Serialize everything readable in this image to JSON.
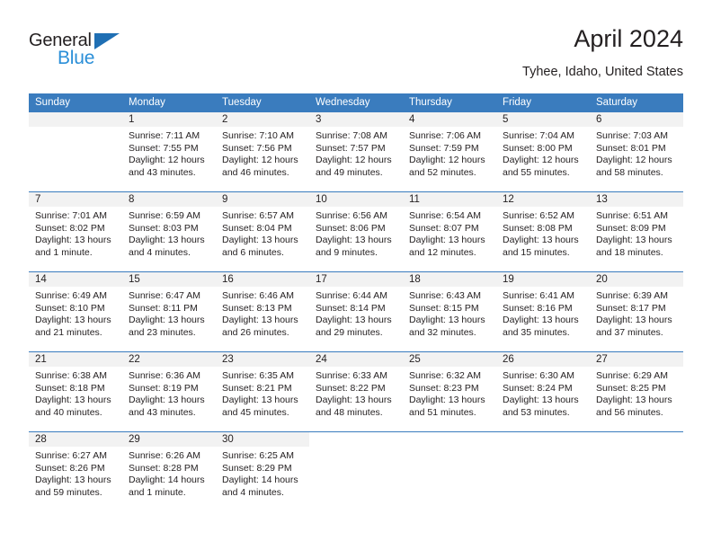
{
  "brand": {
    "name_top": "General",
    "name_bottom": "Blue"
  },
  "header": {
    "title": "April 2024",
    "subtitle": "Tyhee, Idaho, United States"
  },
  "colors": {
    "header_blue": "#3a7cbe",
    "logo_blue": "#2b8fd8",
    "daynum_band": "#f2f2f2",
    "text": "#231f20"
  },
  "weekdays": [
    "Sunday",
    "Monday",
    "Tuesday",
    "Wednesday",
    "Thursday",
    "Friday",
    "Saturday"
  ],
  "weeks": [
    [
      {
        "day": "",
        "lines": []
      },
      {
        "day": "1",
        "lines": [
          "Sunrise: 7:11 AM",
          "Sunset: 7:55 PM",
          "Daylight: 12 hours",
          "and 43 minutes."
        ]
      },
      {
        "day": "2",
        "lines": [
          "Sunrise: 7:10 AM",
          "Sunset: 7:56 PM",
          "Daylight: 12 hours",
          "and 46 minutes."
        ]
      },
      {
        "day": "3",
        "lines": [
          "Sunrise: 7:08 AM",
          "Sunset: 7:57 PM",
          "Daylight: 12 hours",
          "and 49 minutes."
        ]
      },
      {
        "day": "4",
        "lines": [
          "Sunrise: 7:06 AM",
          "Sunset: 7:59 PM",
          "Daylight: 12 hours",
          "and 52 minutes."
        ]
      },
      {
        "day": "5",
        "lines": [
          "Sunrise: 7:04 AM",
          "Sunset: 8:00 PM",
          "Daylight: 12 hours",
          "and 55 minutes."
        ]
      },
      {
        "day": "6",
        "lines": [
          "Sunrise: 7:03 AM",
          "Sunset: 8:01 PM",
          "Daylight: 12 hours",
          "and 58 minutes."
        ]
      }
    ],
    [
      {
        "day": "7",
        "lines": [
          "Sunrise: 7:01 AM",
          "Sunset: 8:02 PM",
          "Daylight: 13 hours",
          "and 1 minute."
        ]
      },
      {
        "day": "8",
        "lines": [
          "Sunrise: 6:59 AM",
          "Sunset: 8:03 PM",
          "Daylight: 13 hours",
          "and 4 minutes."
        ]
      },
      {
        "day": "9",
        "lines": [
          "Sunrise: 6:57 AM",
          "Sunset: 8:04 PM",
          "Daylight: 13 hours",
          "and 6 minutes."
        ]
      },
      {
        "day": "10",
        "lines": [
          "Sunrise: 6:56 AM",
          "Sunset: 8:06 PM",
          "Daylight: 13 hours",
          "and 9 minutes."
        ]
      },
      {
        "day": "11",
        "lines": [
          "Sunrise: 6:54 AM",
          "Sunset: 8:07 PM",
          "Daylight: 13 hours",
          "and 12 minutes."
        ]
      },
      {
        "day": "12",
        "lines": [
          "Sunrise: 6:52 AM",
          "Sunset: 8:08 PM",
          "Daylight: 13 hours",
          "and 15 minutes."
        ]
      },
      {
        "day": "13",
        "lines": [
          "Sunrise: 6:51 AM",
          "Sunset: 8:09 PM",
          "Daylight: 13 hours",
          "and 18 minutes."
        ]
      }
    ],
    [
      {
        "day": "14",
        "lines": [
          "Sunrise: 6:49 AM",
          "Sunset: 8:10 PM",
          "Daylight: 13 hours",
          "and 21 minutes."
        ]
      },
      {
        "day": "15",
        "lines": [
          "Sunrise: 6:47 AM",
          "Sunset: 8:11 PM",
          "Daylight: 13 hours",
          "and 23 minutes."
        ]
      },
      {
        "day": "16",
        "lines": [
          "Sunrise: 6:46 AM",
          "Sunset: 8:13 PM",
          "Daylight: 13 hours",
          "and 26 minutes."
        ]
      },
      {
        "day": "17",
        "lines": [
          "Sunrise: 6:44 AM",
          "Sunset: 8:14 PM",
          "Daylight: 13 hours",
          "and 29 minutes."
        ]
      },
      {
        "day": "18",
        "lines": [
          "Sunrise: 6:43 AM",
          "Sunset: 8:15 PM",
          "Daylight: 13 hours",
          "and 32 minutes."
        ]
      },
      {
        "day": "19",
        "lines": [
          "Sunrise: 6:41 AM",
          "Sunset: 8:16 PM",
          "Daylight: 13 hours",
          "and 35 minutes."
        ]
      },
      {
        "day": "20",
        "lines": [
          "Sunrise: 6:39 AM",
          "Sunset: 8:17 PM",
          "Daylight: 13 hours",
          "and 37 minutes."
        ]
      }
    ],
    [
      {
        "day": "21",
        "lines": [
          "Sunrise: 6:38 AM",
          "Sunset: 8:18 PM",
          "Daylight: 13 hours",
          "and 40 minutes."
        ]
      },
      {
        "day": "22",
        "lines": [
          "Sunrise: 6:36 AM",
          "Sunset: 8:19 PM",
          "Daylight: 13 hours",
          "and 43 minutes."
        ]
      },
      {
        "day": "23",
        "lines": [
          "Sunrise: 6:35 AM",
          "Sunset: 8:21 PM",
          "Daylight: 13 hours",
          "and 45 minutes."
        ]
      },
      {
        "day": "24",
        "lines": [
          "Sunrise: 6:33 AM",
          "Sunset: 8:22 PM",
          "Daylight: 13 hours",
          "and 48 minutes."
        ]
      },
      {
        "day": "25",
        "lines": [
          "Sunrise: 6:32 AM",
          "Sunset: 8:23 PM",
          "Daylight: 13 hours",
          "and 51 minutes."
        ]
      },
      {
        "day": "26",
        "lines": [
          "Sunrise: 6:30 AM",
          "Sunset: 8:24 PM",
          "Daylight: 13 hours",
          "and 53 minutes."
        ]
      },
      {
        "day": "27",
        "lines": [
          "Sunrise: 6:29 AM",
          "Sunset: 8:25 PM",
          "Daylight: 13 hours",
          "and 56 minutes."
        ]
      }
    ],
    [
      {
        "day": "28",
        "lines": [
          "Sunrise: 6:27 AM",
          "Sunset: 8:26 PM",
          "Daylight: 13 hours",
          "and 59 minutes."
        ]
      },
      {
        "day": "29",
        "lines": [
          "Sunrise: 6:26 AM",
          "Sunset: 8:28 PM",
          "Daylight: 14 hours",
          "and 1 minute."
        ]
      },
      {
        "day": "30",
        "lines": [
          "Sunrise: 6:25 AM",
          "Sunset: 8:29 PM",
          "Daylight: 14 hours",
          "and 4 minutes."
        ]
      },
      {
        "day": "",
        "lines": []
      },
      {
        "day": "",
        "lines": []
      },
      {
        "day": "",
        "lines": []
      },
      {
        "day": "",
        "lines": []
      }
    ]
  ]
}
